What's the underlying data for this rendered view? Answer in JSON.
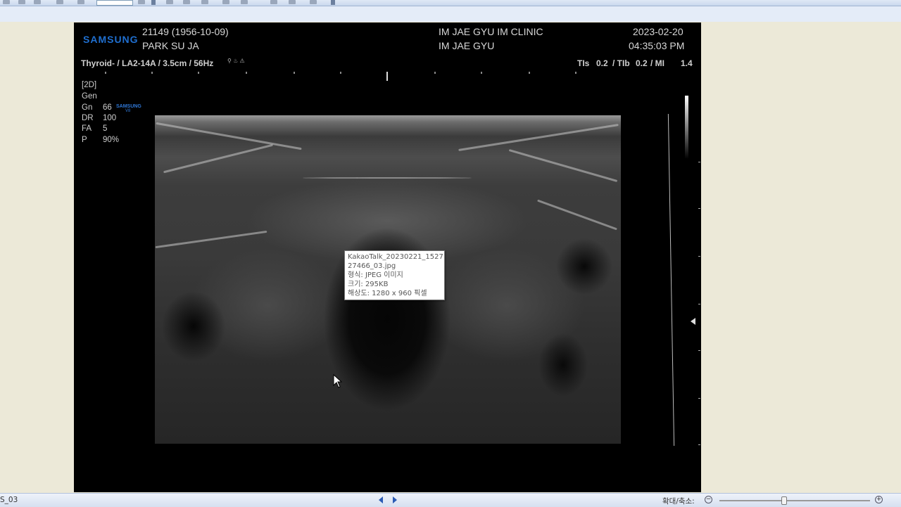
{
  "ultrasound": {
    "brand": "SAMSUNG",
    "patient_id": "21149 (1956-10-09)",
    "patient_name": "PARK SU JA",
    "clinic": "IM JAE GYU IM CLINIC",
    "physician": "IM JAE GYU",
    "date": "2023-02-20",
    "time": "04:35:03 PM",
    "probe_info": "Thyroid- / LA2-14A / 3.5cm / 56Hz",
    "indices": {
      "tis_label": "TIs",
      "tis_value": "0.2",
      "tib_label": "/ TIb",
      "tib_value": "0.2",
      "mi_label": "/ MI",
      "mi_value": "1.4"
    },
    "mode": "[2D]",
    "preset": "Gen",
    "params": [
      {
        "label": "Gn",
        "value": "66"
      },
      {
        "label": "DR",
        "value": "100"
      },
      {
        "label": "FA",
        "value": "5"
      },
      {
        "label": "P",
        "value": "90%"
      }
    ],
    "small_logo": "SAMSUNG",
    "small_logo_sub": "V8"
  },
  "tooltip": {
    "name_line1": "KakaoTalk_20230221_1527",
    "name_line2": "27466_03.jpg",
    "type": "형식: JPEG 이미지",
    "size": "크기: 295KB",
    "resolution": "해상도: 1280 x 960 픽셀"
  },
  "status_bar": {
    "filename": "S_03",
    "zoom_label": "확대/축소:",
    "zoom_out": "−",
    "zoom_in": "+",
    "zoom_level": 0.43
  },
  "colors": {
    "samsung_blue": "#1f6fd0",
    "frame_bg": "#000000",
    "viewer_bg": "#ece9d8"
  }
}
